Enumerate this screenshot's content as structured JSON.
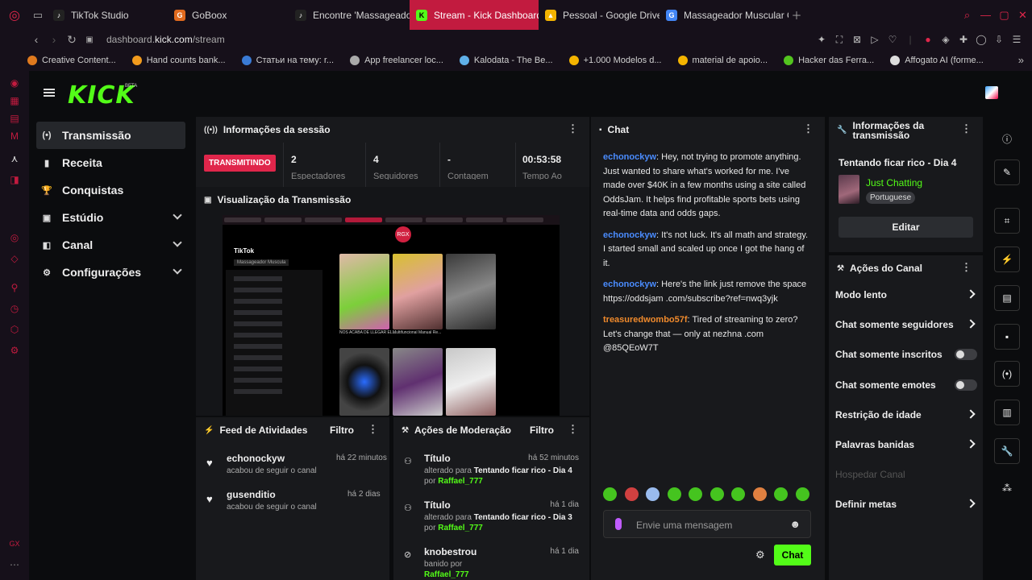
{
  "browser": {
    "tabs": [
      {
        "label": "TikTok Studio",
        "color": "#222222",
        "glyph": "♪"
      },
      {
        "label": "GoBoox",
        "color": "#e06a1e",
        "glyph": "G"
      },
      {
        "label": "Encontre 'Massageador M",
        "color": "#222222",
        "glyph": "♪"
      },
      {
        "label": "Stream - Kick Dashboard",
        "color": "#53fc18",
        "glyph": "K"
      },
      {
        "label": "Pessoal - Google Drive",
        "color": "#f4b400",
        "glyph": "▲"
      },
      {
        "label": "Massageador Muscular O",
        "color": "#4285f4",
        "glyph": "G"
      }
    ],
    "url_prefix": "dashboard.",
    "url_domain": "kick.com",
    "url_path": "/stream",
    "bookmarks": [
      {
        "label": "Creative Content...",
        "color": "#e07a1e"
      },
      {
        "label": "Hand counts bank...",
        "color": "#f29b1d"
      },
      {
        "label": "Статьи на тему: r...",
        "color": "#3a7bd5"
      },
      {
        "label": "App freelancer loc...",
        "color": "#aaaaaa"
      },
      {
        "label": "Kalodata - The Be...",
        "color": "#5fb0e8"
      },
      {
        "label": "+1.000 Modelos d...",
        "color": "#f4b400"
      },
      {
        "label": "material de apoio...",
        "color": "#f4b400"
      },
      {
        "label": "Hacker das Ferra...",
        "color": "#53c41f"
      },
      {
        "label": "Affogato AI (forme...",
        "color": "#dddddd"
      }
    ]
  },
  "app": {
    "logo": "KICK",
    "beta": "BETA",
    "menu": [
      {
        "label": "Transmissão",
        "icon": "broadcast-icon",
        "glyph": "(•)",
        "active": true,
        "chevron": false
      },
      {
        "label": "Receita",
        "icon": "receipt-icon",
        "glyph": "▮",
        "active": false,
        "chevron": false
      },
      {
        "label": "Conquistas",
        "icon": "trophy-icon",
        "glyph": "🏆",
        "active": false,
        "chevron": false
      },
      {
        "label": "Estúdio",
        "icon": "studio-icon",
        "glyph": "▣",
        "active": false,
        "chevron": true
      },
      {
        "label": "Canal",
        "icon": "channel-icon",
        "glyph": "◧",
        "active": false,
        "chevron": true
      },
      {
        "label": "Configurações",
        "icon": "gear-icon",
        "glyph": "⚙",
        "active": false,
        "chevron": true
      }
    ]
  },
  "session": {
    "title": "Informações da sessão",
    "badge": "TRANSMITINDO",
    "stats": [
      {
        "value": "2",
        "label": "Espectadores"
      },
      {
        "value": "4",
        "label": "Seguidores"
      },
      {
        "value": "-",
        "label": "Contagem"
      },
      {
        "value": "00:53:58",
        "label": "Tempo Ao"
      }
    ]
  },
  "preview": {
    "title": "Visualização da Transmissão",
    "tiktok": "TikTok",
    "search": "Massageador Muscula",
    "overlay": "RGX",
    "caption": "NOS ACABA DE LLEGAR EL...",
    "caption2": "Multifuncional Manual Re..."
  },
  "feed": {
    "title": "Feed de Atividades",
    "filter": "Filtro",
    "items": [
      {
        "name": "echonockyw",
        "sub": "acabou de seguir o canal",
        "time": "há 22 minutos"
      },
      {
        "name": "gusenditio",
        "sub": "acabou de seguir o canal",
        "time": "há 2 dias"
      }
    ]
  },
  "mod": {
    "title": "Ações de Moderação",
    "filter": "Filtro",
    "items": [
      {
        "name": "Título",
        "pre": "alterado para ",
        "bold": "Tentando ficar rico - Dia 4",
        "by": "por ",
        "user": "Raffael_777",
        "time": "há 52 minutos"
      },
      {
        "name": "Título",
        "pre": "alterado para ",
        "bold": "Tentando ficar rico - Dia 3",
        "by": "por ",
        "user": "Raffael_777",
        "time": "há 1 dia"
      },
      {
        "name": "knobestrou",
        "pre": "banido por ",
        "bold": "",
        "by": "",
        "user": "Raffael_777",
        "time": "há 1 dia"
      }
    ]
  },
  "chat": {
    "title": "Chat",
    "messages": [
      {
        "user": "echonockyw",
        "color": "#4a8cff",
        "text": "Hey, not trying to promote anything. Just wanted to share what's worked for me. I've made over $40K in a few months using a site called OddsJam. It helps find profitable sports bets using real-time data and odds gaps."
      },
      {
        "user": "echonockyw",
        "color": "#4a8cff",
        "text": "It's not luck. It's all math and strategy. I started small and scaled up once I got the hang of it."
      },
      {
        "user": "echonockyw",
        "color": "#4a8cff",
        "text": "Here's the link just remove the space https://oddsjam .com/subscribe?ref=nwq3yjk"
      },
      {
        "user": "treasuredwombo57f",
        "color": "#f08a2c",
        "text": "Tired of streaming to zero? Let's change that — only at nezhna .com @85QEoW7T"
      }
    ],
    "placeholder": "Envie uma mensagem",
    "send": "Chat"
  },
  "info": {
    "title_line1": "Informações da",
    "title_line2": "transmissão",
    "stream_title": "Tentando ficar rico - Dia 4",
    "category": "Just Chatting",
    "language": "Portuguese",
    "edit": "Editar"
  },
  "actions": {
    "title": "Ações do Canal",
    "items": [
      {
        "label": "Modo lento",
        "kind": "arrow"
      },
      {
        "label": "Chat somente seguidores",
        "kind": "arrow"
      },
      {
        "label": "Chat somente inscritos",
        "kind": "toggle"
      },
      {
        "label": "Chat somente emotes",
        "kind": "toggle"
      },
      {
        "label": "Restrição de idade",
        "kind": "arrow"
      },
      {
        "label": "Palavras banidas",
        "kind": "arrow"
      },
      {
        "label": "Hospedar Canal",
        "kind": "disabled"
      },
      {
        "label": "Definir metas",
        "kind": "arrow"
      }
    ]
  }
}
